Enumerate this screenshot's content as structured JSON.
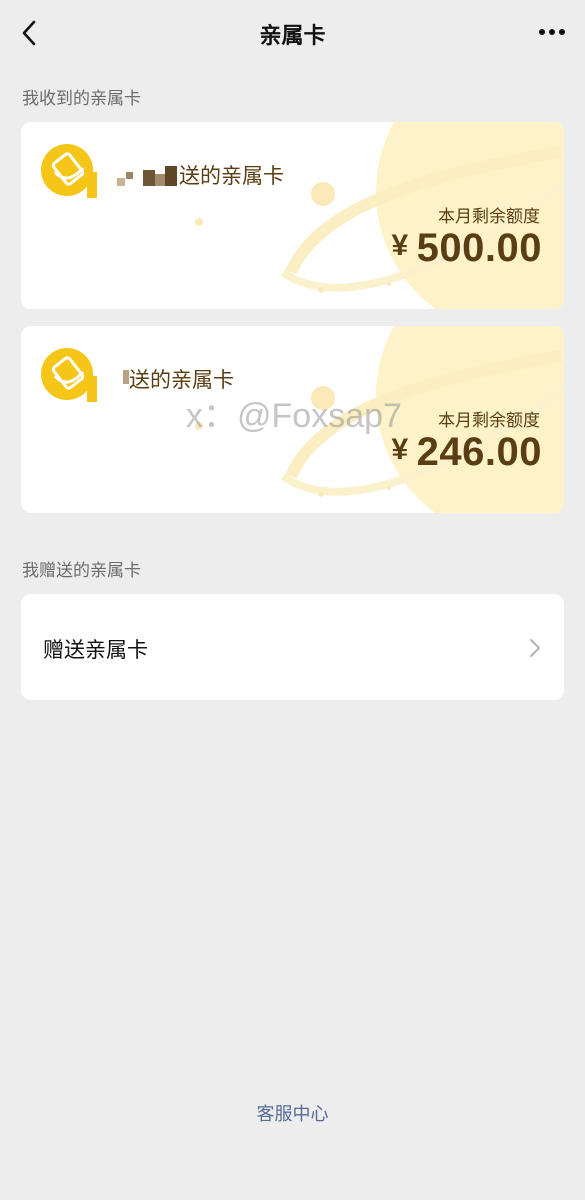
{
  "nav": {
    "title": "亲属卡"
  },
  "received_section": {
    "title": "我收到的亲属卡",
    "cards": [
      {
        "sender_text": "送的亲属卡",
        "balance_label": "本月剩余额度",
        "currency": "¥",
        "amount": "500.00"
      },
      {
        "sender_text": "送的亲属卡",
        "balance_label": "本月剩余额度",
        "currency": "¥",
        "amount": "246.00"
      }
    ]
  },
  "sent_section": {
    "title": "我赠送的亲属卡",
    "gift_label": "赠送亲属卡"
  },
  "watermark": "x：@Foxsap7",
  "footer": {
    "link": "客服中心"
  },
  "colors": {
    "background": "#ededed",
    "card_text": "#5a3d12",
    "logo_yellow": "#f5c518",
    "deco_yellow": "#fdf2c8",
    "link_blue": "#576b95"
  },
  "icons": [
    "back-arrow-icon",
    "more-dots-icon",
    "card-logo-icon",
    "chevron-right-icon"
  ]
}
